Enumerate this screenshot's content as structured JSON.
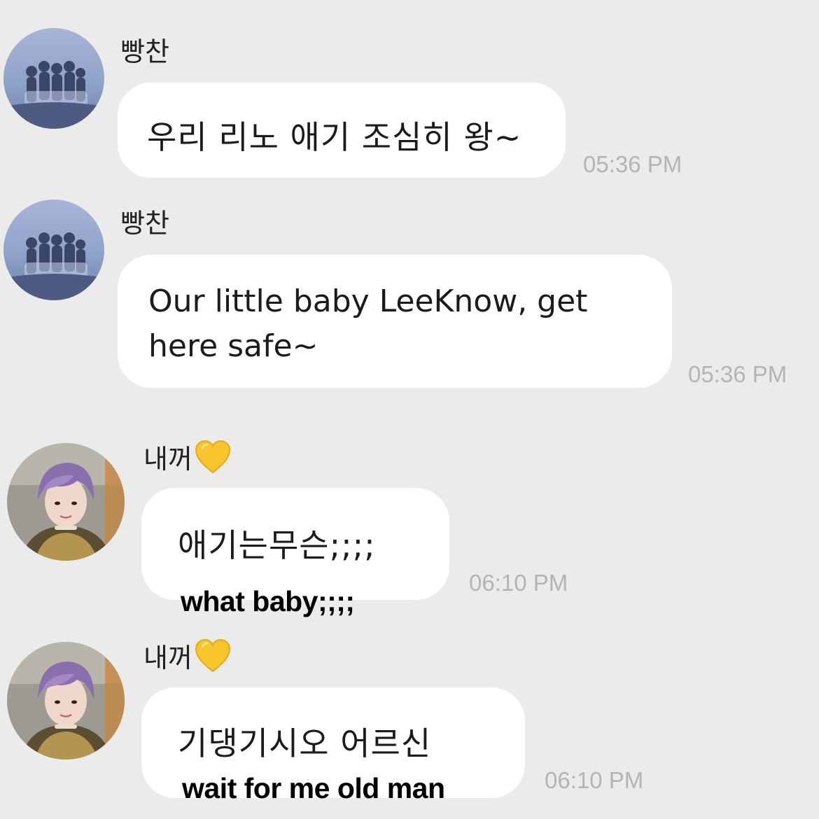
{
  "messages": [
    {
      "sender": "빵찬",
      "text": "우리 리노 애기 조심히 왕~",
      "time": "05:36 PM",
      "avatar": "group-photo-avatar"
    },
    {
      "sender": "빵찬",
      "text": "Our little baby LeeKnow, get here safe~",
      "time": "05:36 PM",
      "avatar": "group-photo-avatar"
    },
    {
      "sender": "내꺼",
      "sender_emoji": "yellow-heart-icon",
      "text": "애기는무슨;;;;",
      "time": "06:10 PM",
      "caption": "what baby;;;;",
      "avatar": "purple-hair-avatar"
    },
    {
      "sender": "내꺼",
      "sender_emoji": "yellow-heart-icon",
      "text": "기댕기시오 어르신",
      "time": "06:10 PM",
      "caption": "wait for me old man",
      "avatar": "purple-hair-avatar"
    }
  ],
  "colors": {
    "background": "#ebebeb",
    "bubble": "#ffffff",
    "time": "#b4b4b4",
    "heart": "#f7c52c"
  }
}
